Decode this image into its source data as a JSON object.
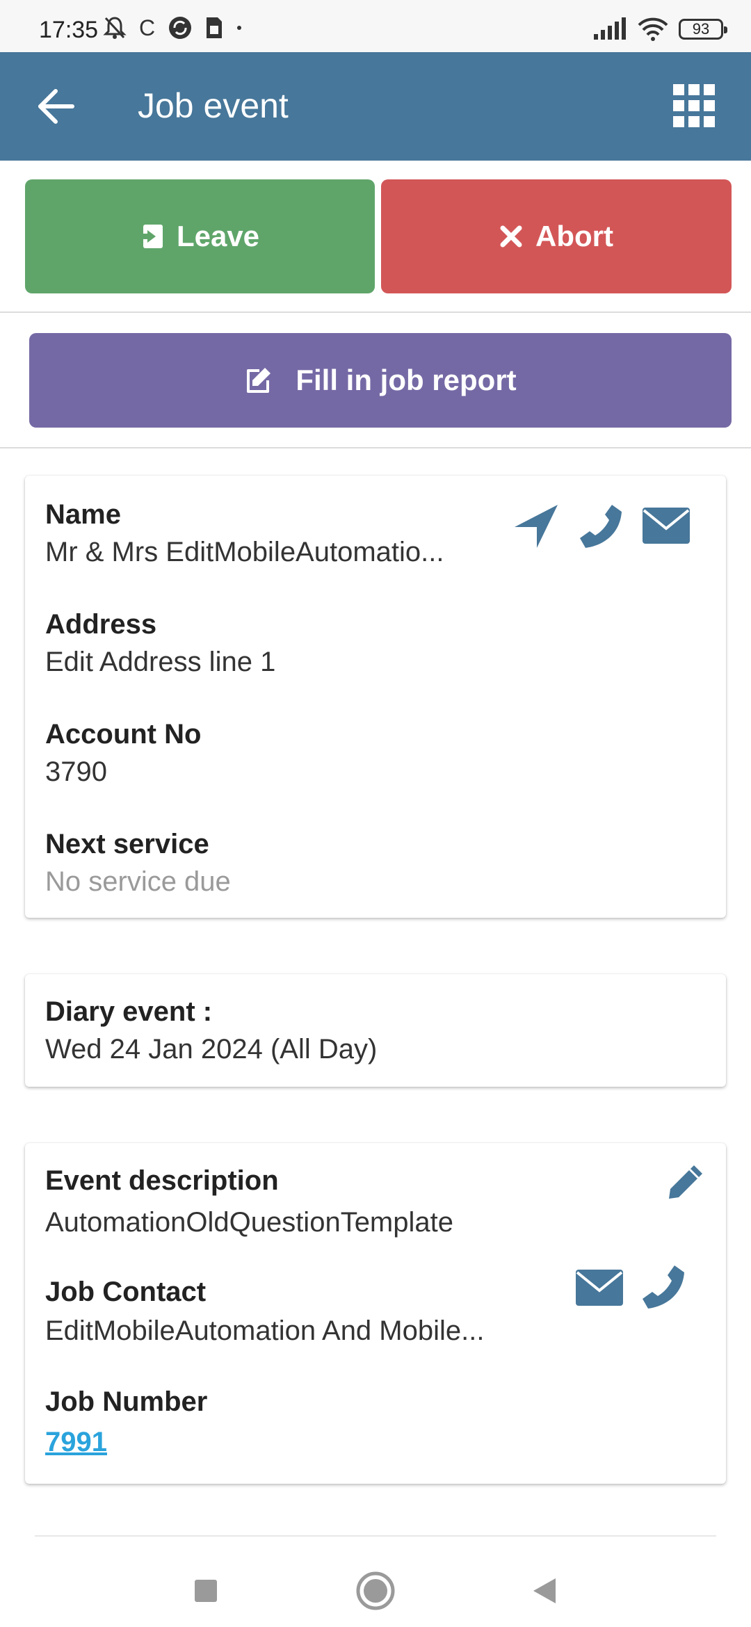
{
  "status_bar": {
    "time": "17:35",
    "carrier_letter": "C",
    "battery": "93"
  },
  "app_bar": {
    "title": "Job event"
  },
  "actions": {
    "leave_label": "Leave",
    "abort_label": "Abort",
    "report_label": "Fill in job report"
  },
  "customer": {
    "name_label": "Name",
    "name_value": "Mr & Mrs EditMobileAutomatio...",
    "address_label": "Address",
    "address_value": "Edit Address line 1",
    "account_label": "Account No",
    "account_value": "3790",
    "service_label": "Next service",
    "service_value": "No service due"
  },
  "diary": {
    "label": "Diary event :",
    "value": "Wed 24 Jan 2024 (All Day)"
  },
  "event": {
    "description_label": "Event description",
    "description_value": "AutomationOldQuestionTemplate",
    "contact_label": "Job Contact",
    "contact_value": "EditMobileAutomation And Mobile...",
    "job_number_label": "Job Number",
    "job_number_value": "7991"
  },
  "colors": {
    "app_bar": "#47779a",
    "leave": "#5fa56a",
    "abort": "#d35657",
    "report": "#7569a5",
    "icon_accent": "#47779a",
    "link": "#2aa3dc"
  },
  "icons": [
    "mute-icon",
    "sync-icon",
    "sim-icon",
    "signal-icon",
    "wifi-icon",
    "battery-icon",
    "back-arrow-icon",
    "grid-icon",
    "enter-icon",
    "close-icon",
    "edit-note-icon",
    "navigate-icon",
    "phone-icon",
    "mail-icon",
    "pencil-icon",
    "nav-square-icon",
    "nav-circle-icon",
    "nav-triangle-icon"
  ]
}
